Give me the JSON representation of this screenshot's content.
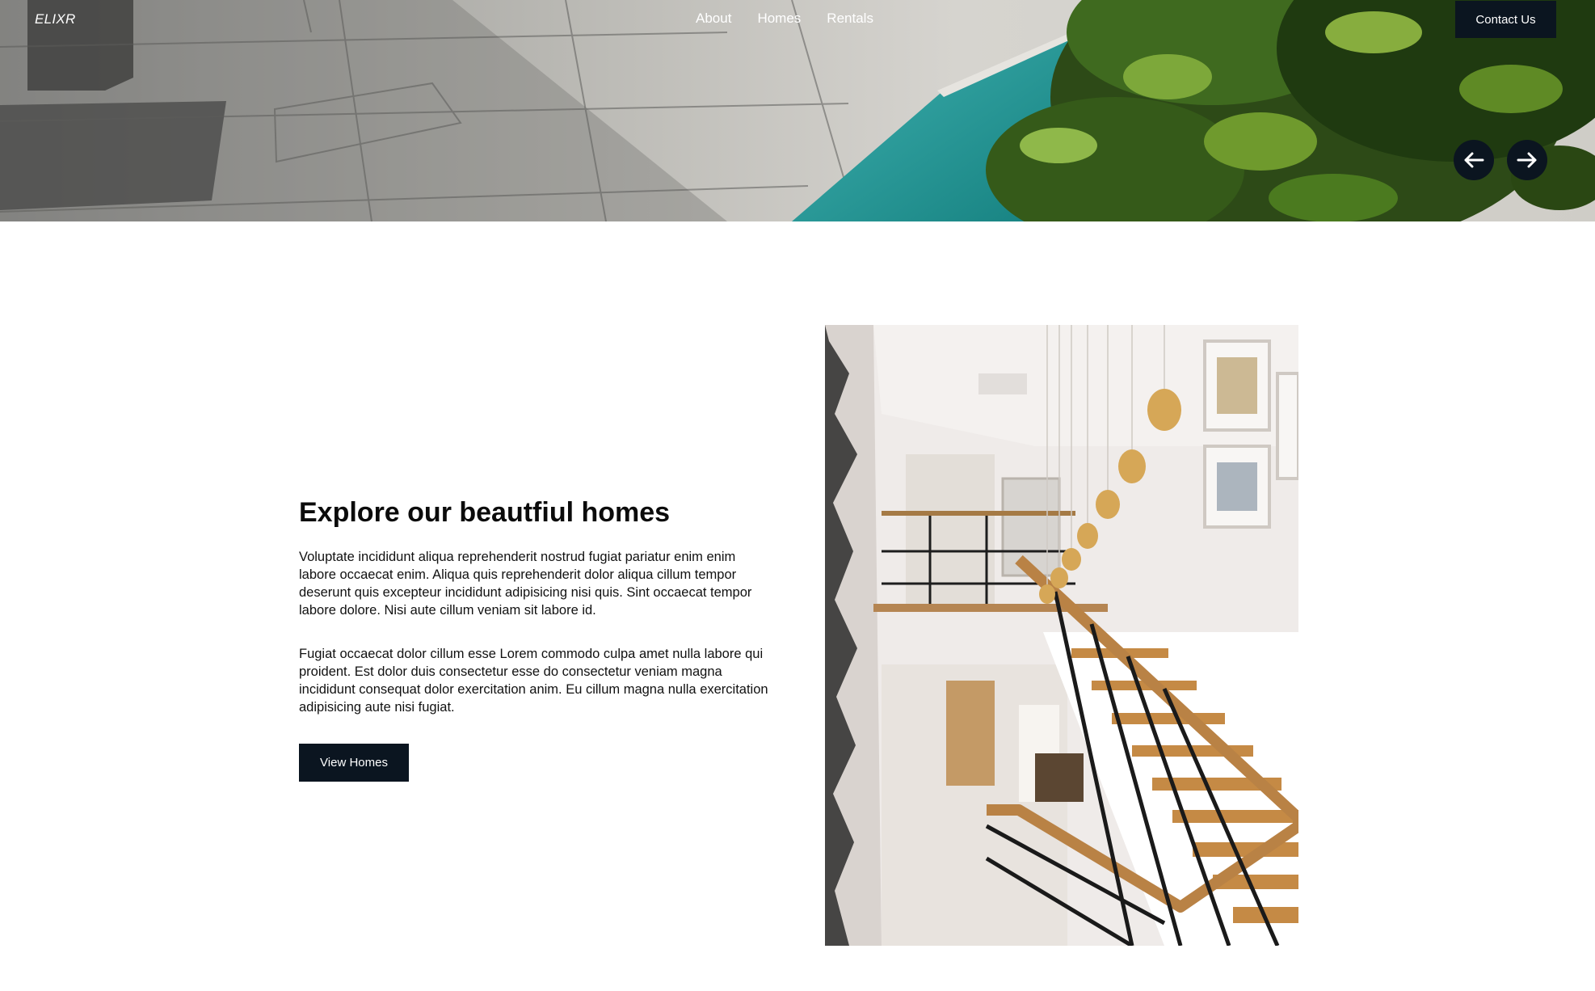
{
  "nav": {
    "logo": "ELIXR",
    "links": [
      "About",
      "Homes",
      "Rentals"
    ],
    "contact_label": "Contact Us"
  },
  "hero": {
    "prev_icon": "arrow-left-icon",
    "next_icon": "arrow-right-icon"
  },
  "feature": {
    "title": "Explore our beautfiul homes",
    "paragraphs": [
      "Voluptate incididunt aliqua reprehenderit nostrud fugiat pariatur enim enim labore occaecat enim. Aliqua quis reprehenderit dolor aliqua cillum tempor deserunt quis excepteur incididunt adipisicing nisi quis. Sint occaecat tempor labore dolore. Nisi aute cillum veniam sit labore id.",
      "Fugiat occaecat dolor cillum esse Lorem commodo culpa amet nulla labore qui proident. Est dolor duis consectetur esse do consectetur veniam magna incididunt consequat dolor exercitation anim. Eu cillum magna nulla exercitation adipisicing aute nisi fugiat."
    ],
    "cta_label": "View Homes"
  },
  "colors": {
    "primary": "#0b1520",
    "text": "#0b0b0b",
    "background": "#ffffff"
  }
}
